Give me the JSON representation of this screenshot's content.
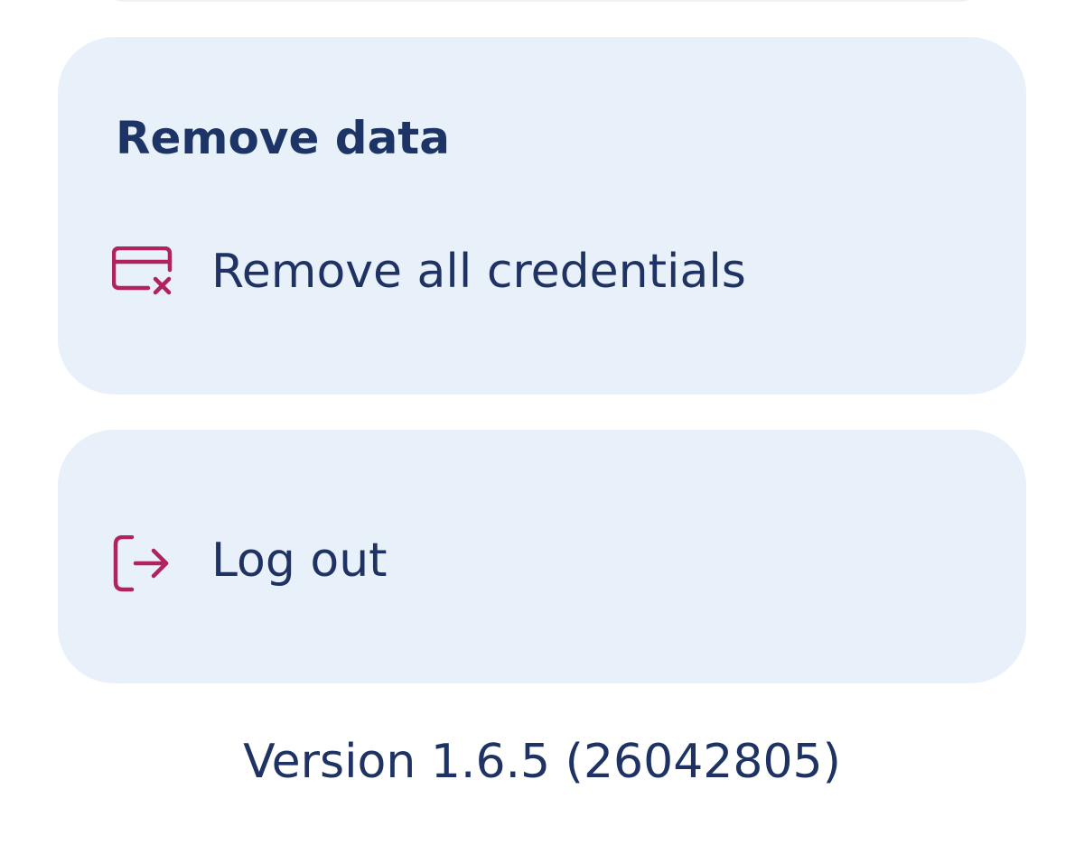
{
  "colors": {
    "card_background": "#e8f0fa",
    "text_primary": "#1e3264",
    "icon_accent": "#b0235f"
  },
  "remove_data": {
    "title": "Remove data",
    "remove_all_credentials": {
      "label": "Remove all credentials",
      "icon": "credential-remove-icon"
    }
  },
  "session": {
    "logout": {
      "label": "Log out",
      "icon": "logout-icon"
    }
  },
  "footer": {
    "version": "Version 1.6.5 (26042805)"
  }
}
